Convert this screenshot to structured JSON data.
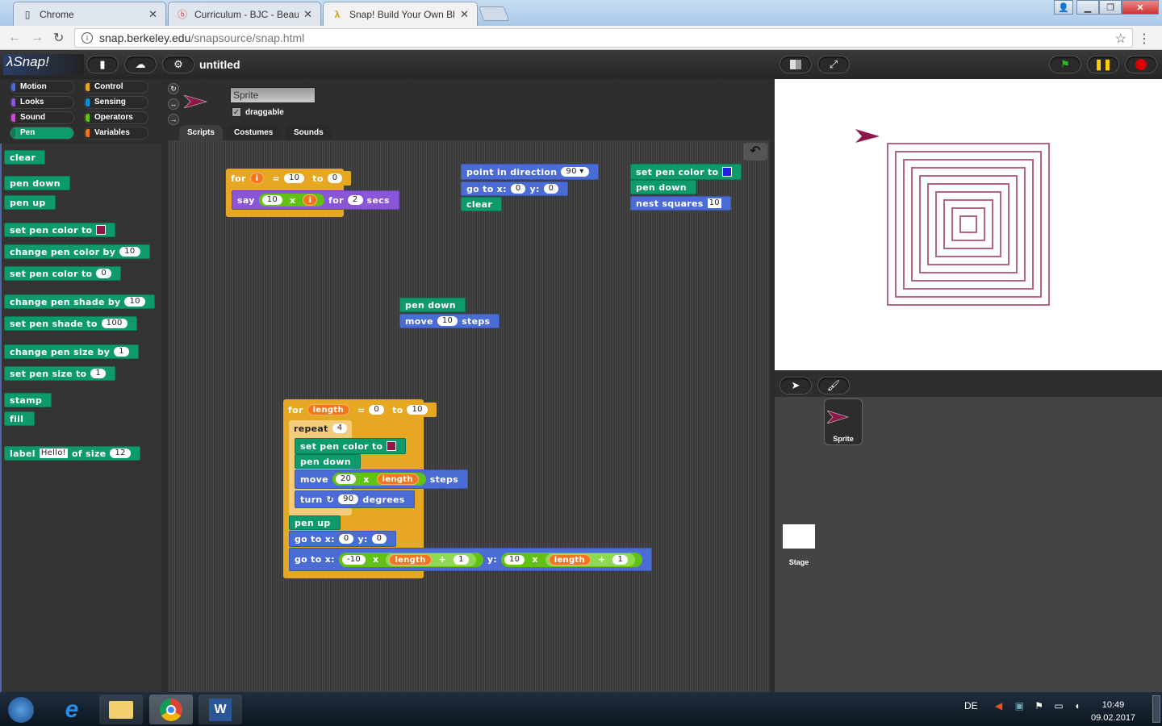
{
  "browser": {
    "tabs": [
      {
        "label": "Chrome",
        "icon": "page-icon",
        "active": false
      },
      {
        "label": "Curriculum - BJC - Beaut",
        "icon": "bjc-icon",
        "active": false
      },
      {
        "label": "Snap! Build Your Own Bl",
        "icon": "lambda-icon",
        "active": true
      }
    ],
    "close_glyph": "✕",
    "url_host": "snap.berkeley.edu",
    "url_path": "/snapsource/snap.html"
  },
  "snap": {
    "logo": "λSnap!",
    "project_title": "untitled",
    "categories": [
      {
        "label": "Motion",
        "color": "#4a6cd4"
      },
      {
        "label": "Looks",
        "color": "#8a55d7"
      },
      {
        "label": "Sound",
        "color": "#cf4ad9"
      },
      {
        "label": "Pen",
        "color": "#0e9a6c",
        "selected": true
      },
      {
        "label": "Control",
        "color": "#e6a822"
      },
      {
        "label": "Sensing",
        "color": "#0494dc"
      },
      {
        "label": "Operators",
        "color": "#62c213"
      },
      {
        "label": "Variables",
        "color": "#f3761d"
      }
    ],
    "palette": {
      "clear": "clear",
      "pen_down": "pen down",
      "pen_up": "pen up",
      "set_pen_color": "set pen color to",
      "pen_color": "#8b1a4a",
      "change_pen_color_by": "change pen color by",
      "change_pen_color_val": "10",
      "set_pen_color_num": "set pen color to",
      "set_pen_color_num_val": "0",
      "change_pen_shade_by": "change pen shade by",
      "change_pen_shade_val": "10",
      "set_pen_shade_to": "set pen shade to",
      "set_pen_shade_val": "100",
      "change_pen_size_by": "change pen size by",
      "change_pen_size_val": "1",
      "set_pen_size_to": "set pen size to",
      "set_pen_size_val": "1",
      "stamp": "stamp",
      "fill": "fill",
      "label": "label",
      "label_text": "Hello!",
      "of_size": "of size",
      "label_size": "12"
    },
    "sprite": {
      "name": "Sprite",
      "draggable_label": "draggable",
      "draggable_checked": "✓"
    },
    "tabs": [
      "Scripts",
      "Costumes",
      "Sounds"
    ],
    "scripts": {
      "s1": {
        "for": "for",
        "var": "i",
        "eq": "=",
        "from": "10",
        "to": "to",
        "to_val": "0",
        "say": "say",
        "mul_a": "10",
        "x": "x",
        "mul_var": "i",
        "for2": "for",
        "secs_val": "2",
        "secs": "secs"
      },
      "s2": {
        "point": "point in direction",
        "dir": "90 ▾",
        "goto": "go to x:",
        "gx": "0",
        "y": "y:",
        "gy": "0",
        "clear": "clear"
      },
      "s3": {
        "setpen": "set pen color to",
        "color": "#2020e0",
        "pendown": "pen down",
        "nest": "nest squares",
        "nest_val": "10"
      },
      "s4": {
        "pendown": "pen down",
        "move": "move",
        "steps_val": "10",
        "steps": "steps"
      },
      "s5": {
        "for": "for",
        "var": "length",
        "eq": "=",
        "from": "0",
        "to": "to",
        "to_val": "10",
        "repeat": "repeat",
        "repeat_val": "4",
        "setpen": "set pen color to",
        "color": "#8b1a4a",
        "pendown": "pen down",
        "move": "move",
        "move_a": "20",
        "x": "x",
        "steps": "steps",
        "turn": "turn",
        "turn_glyph": "↻",
        "turn_val": "90",
        "degrees": "degrees",
        "penup": "pen up",
        "goto": "go to x:",
        "gx": "0",
        "y": "y:",
        "gy": "0",
        "goto2": "go to x:",
        "x_a": "-10",
        "plus": "+",
        "one": "1",
        "y_a": "10"
      }
    },
    "corral": {
      "sprite_label": "Sprite",
      "stage_label": "Stage"
    },
    "stage": {
      "pen_color": "#b5657f",
      "squares": 10
    }
  },
  "taskbar": {
    "lang": "DE",
    "time": "10:49",
    "date": "09.02.2017"
  }
}
